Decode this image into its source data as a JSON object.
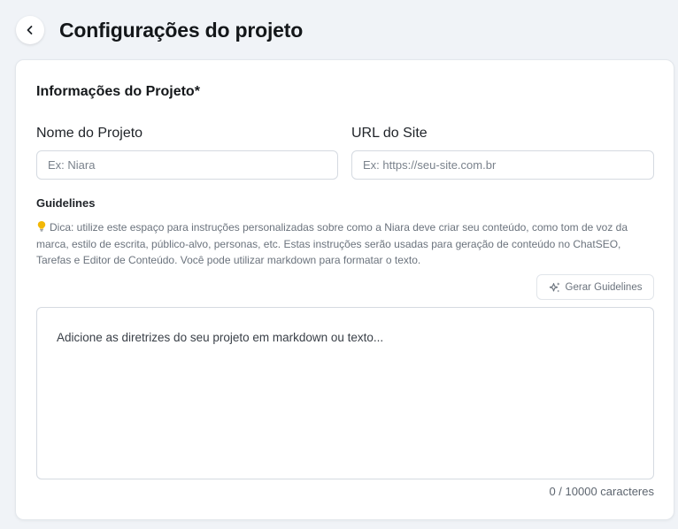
{
  "header": {
    "title": "Configurações do projeto",
    "back_icon": "chevron-left-icon"
  },
  "section": {
    "title": "Informações do Projeto*"
  },
  "fields": {
    "name_label": "Nome do Projeto",
    "name_placeholder": "Ex: Niara",
    "name_value": "",
    "url_label": "URL do Site",
    "url_placeholder": "Ex: https://seu-site.com.br",
    "url_value": ""
  },
  "guidelines": {
    "label": "Guidelines",
    "tip_icon": "lightbulb-icon",
    "tip_text": "Dica: utilize este espaço para instruções personalizadas sobre como a Niara deve criar seu conteúdo, como tom de voz da marca, estilo de escrita, público-alvo, personas, etc. Estas instruções serão usadas para geração de conteúdo no ChatSEO, Tarefas e Editor de Conteúdo. Você pode utilizar markdown para formatar o texto.",
    "generate_button_label": "Gerar Guidelines",
    "generate_button_icon": "sparkles-icon",
    "textarea_placeholder": "Adicione as diretrizes do seu projeto em markdown ou texto...",
    "textarea_value": "",
    "char_count": "0 / 10000 caracteres"
  },
  "colors": {
    "page_background": "#f0f3f7",
    "card_background": "#ffffff",
    "border": "#d5dae1",
    "muted_text": "#6b737d",
    "lightbulb": "#f2b705"
  }
}
